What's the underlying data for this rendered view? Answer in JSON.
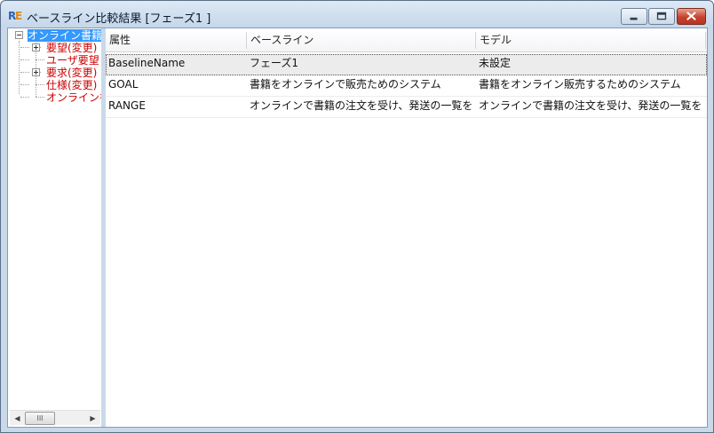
{
  "window": {
    "title": "ベースライン比較結果 [フェーズ1 ]",
    "icon": "app-logo-icon",
    "buttons": [
      "minimize-icon",
      "maximize-icon",
      "close-icon"
    ]
  },
  "tree": {
    "items": [
      {
        "label": "オンライン書籍",
        "selected": true,
        "expander": "minus"
      },
      {
        "label": "要望(変更)",
        "expander": "plus"
      },
      {
        "label": "ユーザ要望",
        "expander": null
      },
      {
        "label": "要求(変更)",
        "expander": "plus"
      },
      {
        "label": "仕様(変更)",
        "expander": null
      },
      {
        "label": "オンライン書",
        "expander": null
      }
    ],
    "scroll_thumb_label": "III"
  },
  "grid": {
    "columns": [
      "属性",
      "ベースライン",
      "モデル"
    ],
    "rows": [
      {
        "attribute": "BaselineName",
        "baseline": "フェーズ1",
        "model": "未設定"
      },
      {
        "attribute": "GOAL",
        "baseline": "書籍をオンラインで販売ためのシステム",
        "model": "書籍をオンライン販売するためのシステム"
      },
      {
        "attribute": "RANGE",
        "baseline": "オンラインで書籍の注文を受け、発送の一覧を",
        "model": "オンラインで書籍の注文を受け、発送の一覧を"
      }
    ]
  },
  "colors": {
    "tree_text": "#cc0000",
    "selection": "#3399ff",
    "frame": "#c9d9ea"
  }
}
